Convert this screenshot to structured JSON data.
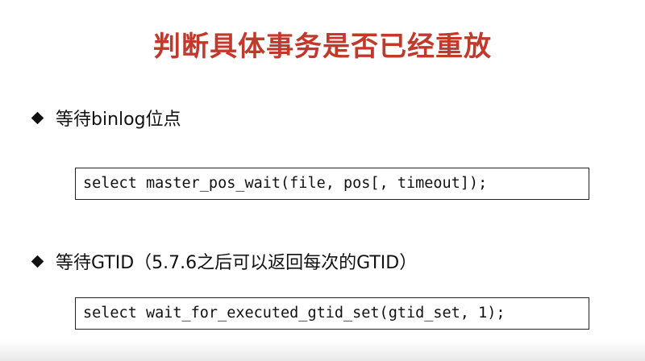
{
  "slide": {
    "title": "判断具体事务是否已经重放",
    "title_color": "#c0392b",
    "items": [
      {
        "bullet": "diamond",
        "text": "等待binlog位点",
        "code": "select master_pos_wait(file, pos[, timeout]);"
      },
      {
        "bullet": "diamond",
        "text": "等待GTID（5.7.6之后可以返回每次的GTID）",
        "code": "select wait_for_executed_gtid_set(gtid_set, 1);"
      }
    ]
  }
}
